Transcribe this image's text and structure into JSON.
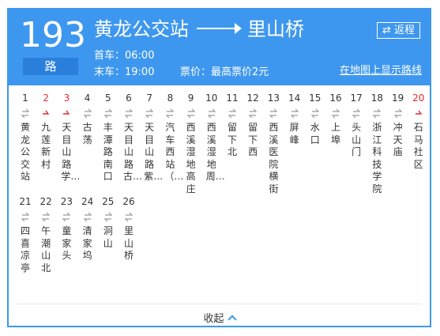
{
  "route": {
    "number": "193",
    "suffix": "路",
    "origin": "黄龙公交站",
    "destination": "里山桥",
    "first_bus": "首车：06:00",
    "last_bus": "末车：19:00",
    "fare": "票价：最高票价2元",
    "return_label": "⇄ 返程",
    "map_link": "在地图上显示路线"
  },
  "stops": [
    {
      "n": "1",
      "name": "黄龙公交站",
      "mark": false
    },
    {
      "n": "2",
      "name": "九莲新村",
      "mark": true
    },
    {
      "n": "3",
      "name": "天目山路学…",
      "mark": true
    },
    {
      "n": "4",
      "name": "古荡",
      "mark": false
    },
    {
      "n": "5",
      "name": "丰潭路南口",
      "mark": false
    },
    {
      "n": "6",
      "name": "天目山路古…",
      "mark": false
    },
    {
      "n": "7",
      "name": "天目山路紫…",
      "mark": false
    },
    {
      "n": "8",
      "name": "汽车西站（…",
      "mark": false
    },
    {
      "n": "9",
      "name": "西溪湿地高庄",
      "mark": false
    },
    {
      "n": "10",
      "name": "西溪湿地周…",
      "mark": false
    },
    {
      "n": "11",
      "name": "留下北",
      "mark": false
    },
    {
      "n": "12",
      "name": "留下西",
      "mark": false
    },
    {
      "n": "13",
      "name": "西溪医院横街",
      "mark": false
    },
    {
      "n": "14",
      "name": "屏峰",
      "mark": false
    },
    {
      "n": "15",
      "name": "水口",
      "mark": false
    },
    {
      "n": "16",
      "name": "上埠",
      "mark": false
    },
    {
      "n": "17",
      "name": "头山门",
      "mark": false
    },
    {
      "n": "18",
      "name": "浙江科技学院",
      "mark": false
    },
    {
      "n": "19",
      "name": "冲天庙",
      "mark": false
    },
    {
      "n": "20",
      "name": "石马社区",
      "mark": true
    },
    {
      "n": "21",
      "name": "四喜凉亭",
      "mark": false
    },
    {
      "n": "22",
      "name": "午潮山北",
      "mark": false
    },
    {
      "n": "23",
      "name": "童家头",
      "mark": false
    },
    {
      "n": "24",
      "name": "清家坞",
      "mark": false
    },
    {
      "n": "25",
      "name": "洞山",
      "mark": false
    },
    {
      "n": "26",
      "name": "里山桥",
      "mark": false
    }
  ],
  "collapse_label": "收起",
  "colors": {
    "accent": "#3e97ee",
    "mark": "#e12b2b",
    "text": "#333333"
  }
}
